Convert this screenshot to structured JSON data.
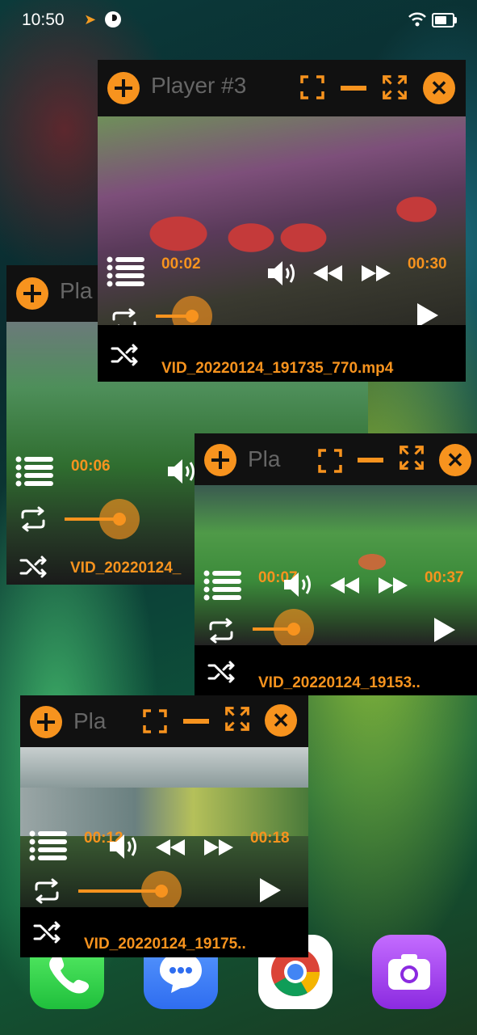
{
  "status_bar": {
    "time": "10:50"
  },
  "players": [
    {
      "id": "p1",
      "name": "Pla",
      "elapsed": "00:06",
      "duration": "",
      "progress": 0.45,
      "filename": "VID_20220124_"
    },
    {
      "id": "p2",
      "name": "Player #3",
      "elapsed": "00:02",
      "duration": "00:30",
      "progress": 0.07,
      "filename": "VID_20220124_191735_770.mp4"
    },
    {
      "id": "p3",
      "name": "Pla",
      "elapsed": "00:07",
      "duration": "00:37",
      "progress": 0.19,
      "filename": "VID_20220124_19153.."
    },
    {
      "id": "p4",
      "name": "Pla",
      "elapsed": "00:12",
      "duration": "00:18",
      "progress": 0.67,
      "filename": "VID_20220124_19175.."
    }
  ],
  "icons": {
    "add": "plus-icon",
    "resize": "resize-icon",
    "minimize": "minimize-icon",
    "fullscreen": "fullscreen-icon",
    "close": "close-icon",
    "playlist": "playlist-icon",
    "volume": "volume-icon",
    "rewind": "rewind-icon",
    "fast_forward": "fast-forward-icon",
    "play": "play-icon",
    "repeat": "repeat-icon",
    "shuffle": "shuffle-icon"
  },
  "dock": [
    "Phone",
    "Messages",
    "Chrome",
    "Camera"
  ],
  "colors": {
    "accent": "#f7931e",
    "title_bg": "#111111",
    "title_text": "#666666"
  }
}
